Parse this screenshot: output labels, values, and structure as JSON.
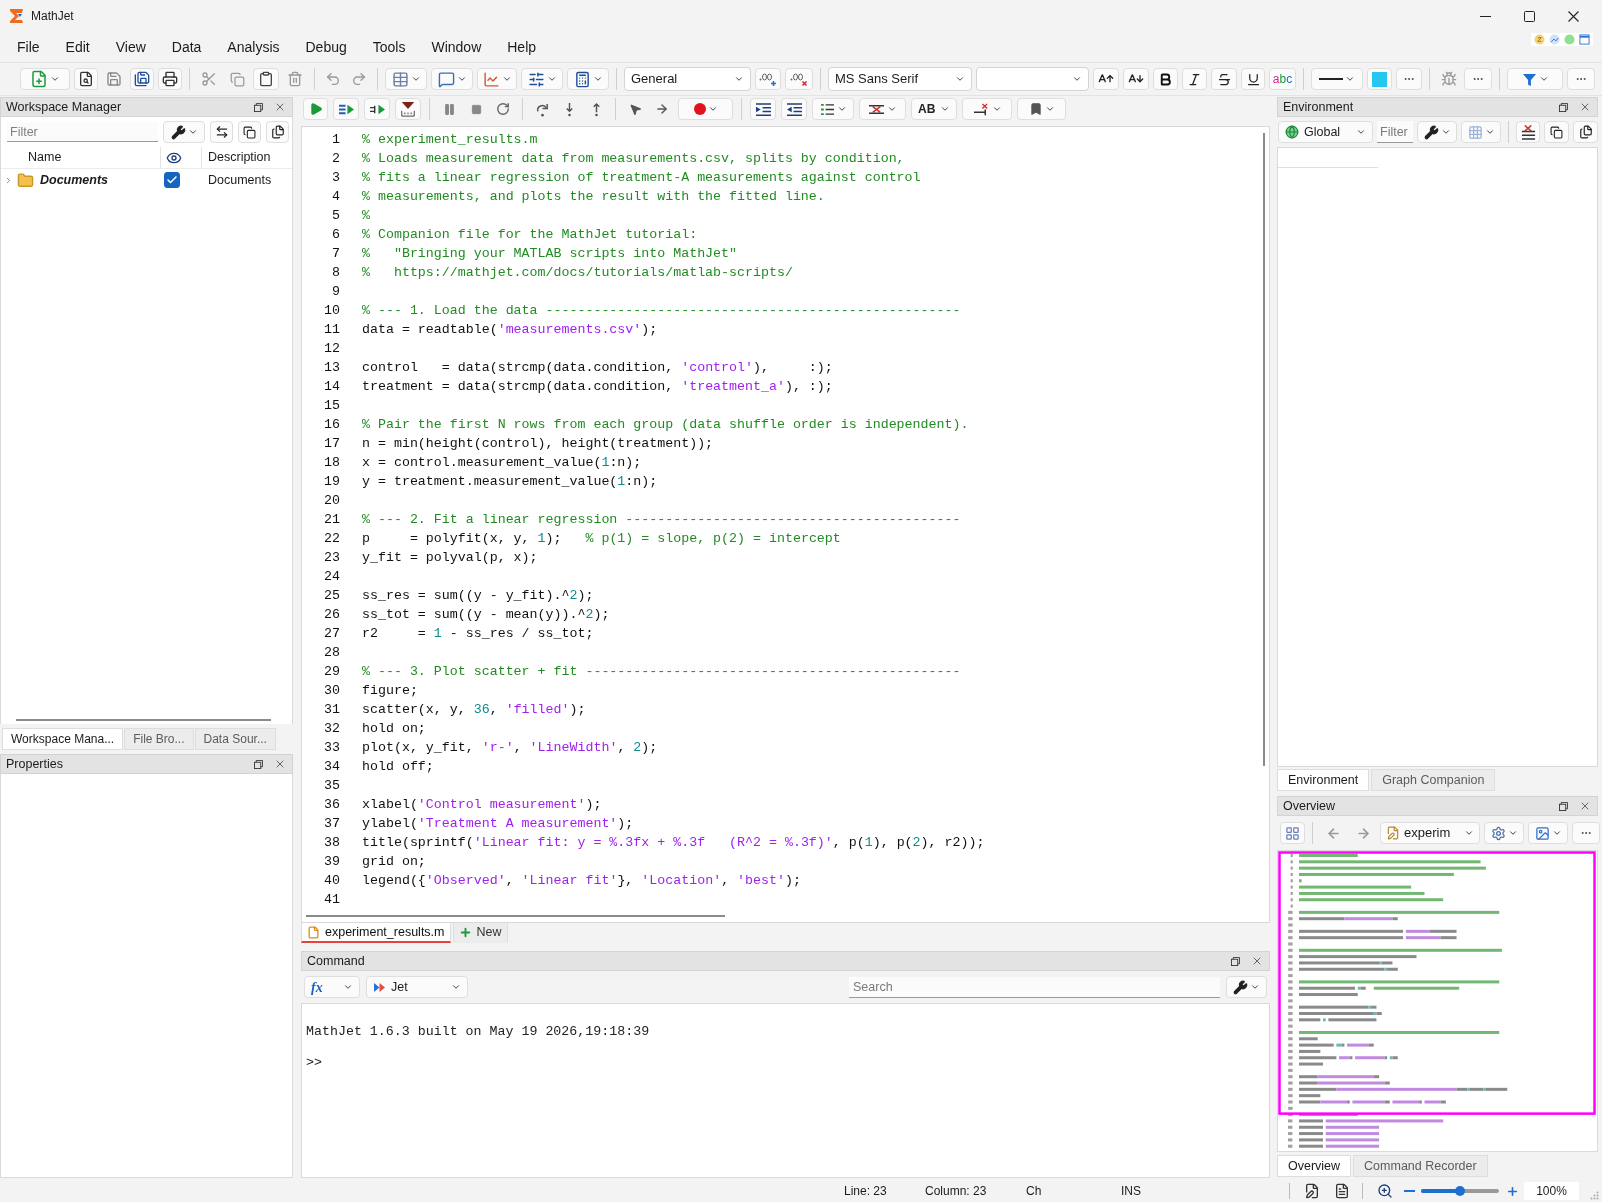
{
  "window": {
    "title": "MathJet"
  },
  "menu": [
    "File",
    "Edit",
    "View",
    "Data",
    "Analysis",
    "Debug",
    "Tools",
    "Window",
    "Help"
  ],
  "toolbar": {
    "number_format": "General",
    "font_name": "MS Sans Serif",
    "text_color_label": "abc"
  },
  "workspace_manager": {
    "title": "Workspace Manager",
    "filter": {
      "placeholder": "Filter"
    },
    "columns": [
      "Name",
      "Description"
    ],
    "rows": [
      {
        "name": "Documents",
        "expanded": false,
        "visible": true,
        "description": "Documents"
      }
    ]
  },
  "left_tabs": [
    {
      "label": "Workspace Mana...",
      "selected": true
    },
    {
      "label": "File Bro...",
      "selected": false
    },
    {
      "label": "Data Sour...",
      "selected": false
    }
  ],
  "properties": {
    "title": "Properties"
  },
  "debug_toolbar": {
    "case_label": "AB"
  },
  "editor": {
    "lines": [
      {
        "number": "1",
        "text": "% experiment_results.m"
      },
      {
        "number": "2",
        "text": "% Loads measurement data from measurements.csv, splits by condition,"
      },
      {
        "number": "3",
        "text": "% fits a linear regression of treatment-A measurements against control"
      },
      {
        "number": "4",
        "text": "% measurements, and plots the result with the fitted line."
      },
      {
        "number": "5",
        "text": "%"
      },
      {
        "number": "6",
        "text": "% Companion file for the MathJet tutorial:"
      },
      {
        "number": "7",
        "text": "%   \"Bringing your MATLAB scripts into MathJet\""
      },
      {
        "number": "8",
        "text": "%   https://mathjet.com/docs/tutorials/matlab-scripts/"
      },
      {
        "number": "9"
      },
      {
        "number": "10",
        "text": "% --- 1. Load the data ----------------------------------------------------"
      },
      {
        "number": "11",
        "text": "data = readtable('measurements.csv');"
      },
      {
        "number": "12"
      },
      {
        "number": "13",
        "text": "control   = data(strcmp(data.condition, 'control'),     :);"
      },
      {
        "number": "14",
        "text": "treatment = data(strcmp(data.condition, 'treatment_a'), :);"
      },
      {
        "number": "15"
      },
      {
        "number": "16",
        "text": "% Pair the first N rows from each group (data shuffle order is independent)."
      },
      {
        "number": "17",
        "text": "n = min(height(control), height(treatment));"
      },
      {
        "number": "18",
        "text": "x = control.measurement_value(1:n);"
      },
      {
        "number": "19",
        "text": "y = treatment.measurement_value(1:n);"
      },
      {
        "number": "20"
      },
      {
        "number": "21",
        "text": "% --- 2. Fit a linear regression ------------------------------------------"
      },
      {
        "number": "22",
        "text": "p     = polyfit(x, y, 1);   % p(1) = slope, p(2) = intercept"
      },
      {
        "number": "23",
        "text": "y_fit = polyval(p, x);"
      },
      {
        "number": "24"
      },
      {
        "number": "25",
        "text": "ss_res = sum((y - y_fit).^2);"
      },
      {
        "number": "26",
        "text": "ss_tot = sum((y - mean(y)).^2);"
      },
      {
        "number": "27",
        "text": "r2     = 1 - ss_res / ss_tot;"
      },
      {
        "number": "28"
      },
      {
        "number": "29",
        "text": "% --- 3. Plot scatter + fit -----------------------------------------------"
      },
      {
        "number": "30",
        "text": "figure;"
      },
      {
        "number": "31",
        "text": "scatter(x, y, 36, 'filled');"
      },
      {
        "number": "32",
        "text": "hold on;"
      },
      {
        "number": "33",
        "text": "plot(x, y_fit, 'r-', 'LineWidth', 2);"
      },
      {
        "number": "34",
        "text": "hold off;"
      },
      {
        "number": "35"
      },
      {
        "number": "36",
        "text": "xlabel('Control measurement');"
      },
      {
        "number": "37",
        "text": "ylabel('Treatment A measurement');"
      },
      {
        "number": "38",
        "text": "title(sprintf('Linear fit: y = %.3fx + %.3f   (R^2 = %.3f)', p(1), p(2), r2));"
      },
      {
        "number": "39",
        "text": "grid on;"
      },
      {
        "number": "40",
        "text": "legend({'Observed', 'Linear fit'}, 'Location', 'best');"
      },
      {
        "number": "41"
      }
    ]
  },
  "editor_tabs": [
    {
      "label": "experiment_results.m",
      "selected": true
    },
    {
      "label": "New",
      "selected": false
    }
  ],
  "command": {
    "title": "Command",
    "function_label": "fx",
    "context": "Jet",
    "search": {
      "placeholder": "Search"
    },
    "output": [
      "MathJet 1.6.3 built on May 19 2026,19:18:39"
    ],
    "prompt": ">>"
  },
  "environment": {
    "title": "Environment",
    "scope": "Global",
    "filter": {
      "placeholder": "Filter"
    }
  },
  "environment_tabs": [
    {
      "label": "Environment",
      "selected": true
    },
    {
      "label": "Graph Companion",
      "selected": false
    }
  ],
  "overview": {
    "title": "Overview",
    "document": "experim"
  },
  "overview_tabs": [
    {
      "label": "Overview",
      "selected": true
    },
    {
      "label": "Command Recorder",
      "selected": false
    }
  ],
  "status_bar": {
    "items": [
      "Line: 23",
      "Column: 23",
      "Ch",
      "INS"
    ],
    "zoom": {
      "level": 0.5,
      "reading": "100%"
    }
  }
}
